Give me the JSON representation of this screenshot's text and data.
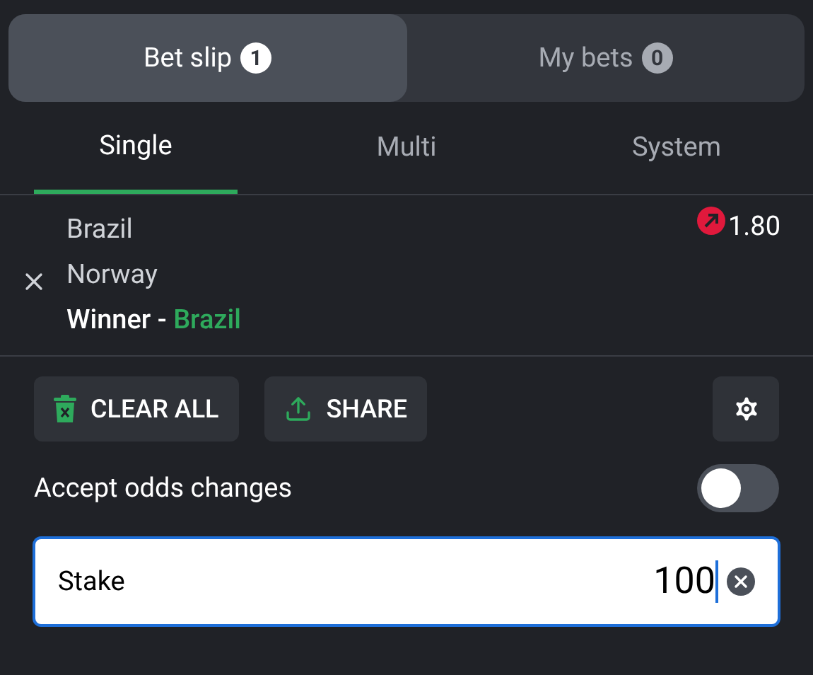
{
  "top_tabs": [
    {
      "label": "Bet slip",
      "count": "1",
      "selected": true
    },
    {
      "label": "My bets",
      "count": "0",
      "selected": false
    }
  ],
  "bet_type_tabs": [
    {
      "label": "Single",
      "selected": true
    },
    {
      "label": "Multi",
      "selected": false
    },
    {
      "label": "System",
      "selected": false
    }
  ],
  "selection": {
    "home": "Brazil",
    "away": "Norway",
    "market": "Winner",
    "separator": "-",
    "pick": "Brazil",
    "odds": "1.80"
  },
  "actions": [
    {
      "label": "CLEAR ALL",
      "kind": "clear"
    },
    {
      "label": "SHARE",
      "kind": "share"
    }
  ],
  "accept_odds_changes": {
    "label": "Accept odds changes",
    "on": false
  },
  "stake": {
    "label": "Stake",
    "value": "100"
  }
}
